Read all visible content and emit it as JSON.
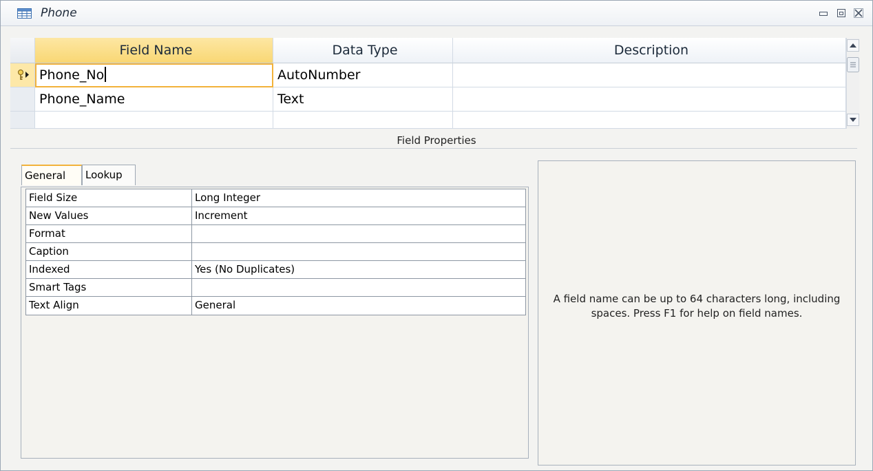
{
  "window": {
    "title": "Phone"
  },
  "grid": {
    "columns": [
      "Field Name",
      "Data Type",
      "Description"
    ],
    "rows": [
      {
        "field_name": "Phone_No",
        "data_type": "AutoNumber",
        "description": "",
        "primary_key": true,
        "current": true
      },
      {
        "field_name": "Phone_Name",
        "data_type": "Text",
        "description": ""
      },
      {
        "field_name": "",
        "data_type": "",
        "description": ""
      }
    ]
  },
  "field_properties": {
    "label": "Field Properties",
    "tabs": [
      "General",
      "Lookup"
    ],
    "active_tab": "General",
    "rows": [
      {
        "name": "Field Size",
        "value": "Long Integer"
      },
      {
        "name": "New Values",
        "value": "Increment"
      },
      {
        "name": "Format",
        "value": ""
      },
      {
        "name": "Caption",
        "value": ""
      },
      {
        "name": "Indexed",
        "value": "Yes (No Duplicates)"
      },
      {
        "name": "Smart Tags",
        "value": ""
      },
      {
        "name": "Text Align",
        "value": "General"
      }
    ],
    "help_text": "A field name can be up to 64 characters long, including spaces. Press F1 for help on field names."
  },
  "icons": {
    "window": "table-icon",
    "controls": [
      "minimize-icon",
      "restore-icon",
      "close-icon"
    ],
    "row_marker": "primary-key-icon",
    "scroll_up": "scroll-up-icon",
    "scroll_down": "scroll-down-icon"
  },
  "colors": {
    "selected_header": "#f9d774",
    "active_tab_accent": "#f2b23a",
    "current_cell_border": "#f2b23a"
  }
}
